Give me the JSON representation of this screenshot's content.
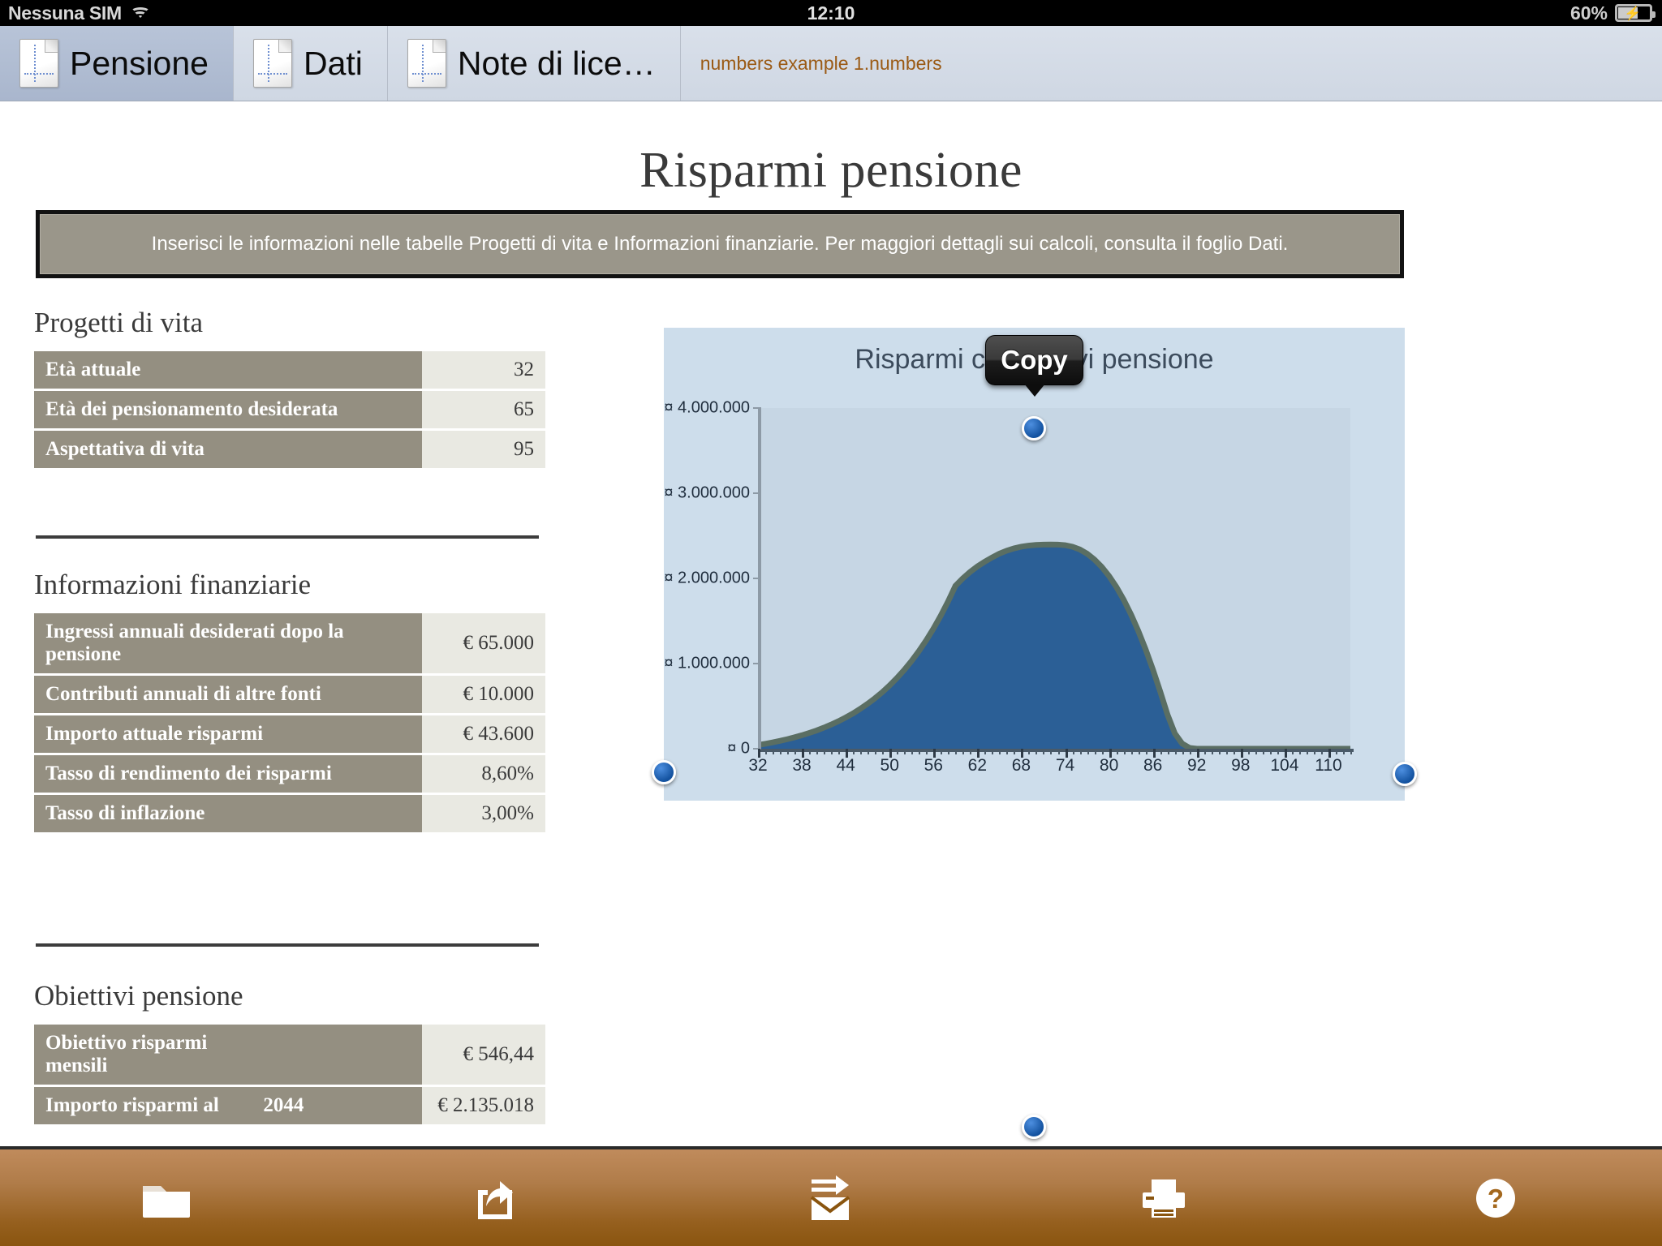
{
  "statusbar": {
    "carrier": "Nessuna SIM",
    "wifi_icon": "wifi-icon",
    "time": "12:10",
    "battery_percent": "60%",
    "battery_icon": "battery-charging-icon"
  },
  "tabbar": {
    "tabs": [
      {
        "label": "Pensione",
        "icon": "sheet-icon",
        "active": true
      },
      {
        "label": "Dati",
        "icon": "sheet-icon",
        "active": false
      },
      {
        "label": "Note di lice…",
        "icon": "sheet-icon",
        "active": false
      }
    ],
    "filename": "numbers example 1.numbers"
  },
  "document": {
    "title": "Risparmi pensione",
    "banner": "Inserisci le informazioni nelle tabelle Progetti di vita e Informazioni finanziarie. Per maggiori dettagli sui calcoli, consulta il foglio Dati."
  },
  "popover": {
    "copy_label": "Copy"
  },
  "tables": [
    {
      "title": "Progetti di vita",
      "rows": [
        {
          "key": "Età attuale",
          "value": "32"
        },
        {
          "key": "Età dei pensionamento desiderata",
          "value": "65"
        },
        {
          "key": "Aspettativa di vita",
          "value": "95"
        }
      ]
    },
    {
      "title": "Informazioni finanziarie",
      "rows": [
        {
          "key": "Ingressi annuali desiderati dopo la pensione",
          "value": "€ 65.000"
        },
        {
          "key": "Contributi annuali di altre fonti",
          "value": "€ 10.000"
        },
        {
          "key": "Importo attuale risparmi",
          "value": "€ 43.600"
        },
        {
          "key": "Tasso di rendimento dei risparmi",
          "value": "8,60%"
        },
        {
          "key": "Tasso di inflazione",
          "value": "3,00%"
        }
      ]
    },
    {
      "title": "Obiettivi pensione",
      "rows": [
        {
          "key": "Obiettivo risparmi mensili",
          "mid": "",
          "value": "€ 546,44"
        },
        {
          "key": "Importo risparmi al",
          "mid": "2044",
          "value": "€ 2.135.018"
        }
      ]
    }
  ],
  "chart_data": {
    "type": "area",
    "title": "Risparmi cumulativi pensione",
    "xlabel": "",
    "ylabel": "",
    "xlim": [
      32,
      113
    ],
    "ylim": [
      0,
      4000000
    ],
    "grid": false,
    "legend": "none",
    "xtick_labels": [
      "32",
      "38",
      "44",
      "50",
      "56",
      "62",
      "68",
      "74",
      "80",
      "86",
      "92",
      "98",
      "104",
      "110"
    ],
    "xtick_values": [
      32,
      38,
      44,
      50,
      56,
      62,
      68,
      74,
      80,
      86,
      92,
      98,
      104,
      110
    ],
    "ytick_labels": [
      "¤ 0",
      "¤ 1.000.000",
      "¤ 2.000.000",
      "¤ 3.000.000",
      "¤ 4.000.000"
    ],
    "ytick_values": [
      0,
      1000000,
      2000000,
      3000000,
      4000000
    ],
    "area_color": "#2b5f96",
    "line_color": "#5a6e63",
    "plot_background": "#c6d6e4",
    "chart_background": "#cdddeb",
    "x": [
      32,
      33,
      34,
      35,
      36,
      37,
      38,
      39,
      40,
      41,
      42,
      43,
      44,
      45,
      46,
      47,
      48,
      49,
      50,
      51,
      52,
      53,
      54,
      55,
      56,
      57,
      58,
      59,
      60,
      61,
      62,
      63,
      64,
      65,
      66,
      67,
      68,
      69,
      70,
      71,
      72,
      73,
      74,
      75,
      76,
      77,
      78,
      79,
      80,
      81,
      82,
      83,
      84,
      85,
      86,
      87,
      88,
      89,
      90,
      91,
      92,
      93,
      94,
      95,
      96,
      97,
      98,
      99,
      100,
      101,
      102,
      103,
      104,
      105,
      106,
      107,
      108,
      109,
      110,
      111,
      112,
      113
    ],
    "y": [
      43600,
      58000,
      74000,
      92000,
      112000,
      134000,
      158000,
      185000,
      214000,
      247000,
      283000,
      323000,
      367000,
      415000,
      469000,
      528000,
      593000,
      664000,
      743000,
      830000,
      925000,
      1030000,
      1145000,
      1272000,
      1411000,
      1563000,
      1730000,
      1913000,
      2000000,
      2075000,
      2140000,
      2195000,
      2245000,
      2290000,
      2325000,
      2352000,
      2372000,
      2385000,
      2393000,
      2397000,
      2398000,
      2396000,
      2390000,
      2372000,
      2340000,
      2290000,
      2222000,
      2135000,
      2028000,
      1900000,
      1750000,
      1578000,
      1384000,
      1168000,
      930000,
      672000,
      400000,
      180000,
      60000,
      10000,
      0,
      0,
      0,
      0,
      0,
      0,
      0,
      0,
      0,
      0,
      0,
      0,
      0,
      0,
      0,
      0,
      0,
      0,
      0,
      0,
      0,
      0
    ],
    "peak": {
      "age": 72,
      "value": 2398000
    },
    "zero_crossing_age": 93
  },
  "toolbar": {
    "buttons": [
      {
        "name": "documents-button",
        "icon": "folder-icon"
      },
      {
        "name": "share-button",
        "icon": "share-icon"
      },
      {
        "name": "send-button",
        "icon": "envelope-send-icon"
      },
      {
        "name": "print-button",
        "icon": "printer-icon"
      },
      {
        "name": "help-button",
        "icon": "question-circle-icon"
      }
    ]
  },
  "handles": [
    {
      "name": "handle-top",
      "pos": "top"
    },
    {
      "name": "handle-left",
      "pos": "left"
    },
    {
      "name": "handle-right",
      "pos": "right"
    },
    {
      "name": "handle-bottom",
      "pos": "bottom"
    }
  ]
}
